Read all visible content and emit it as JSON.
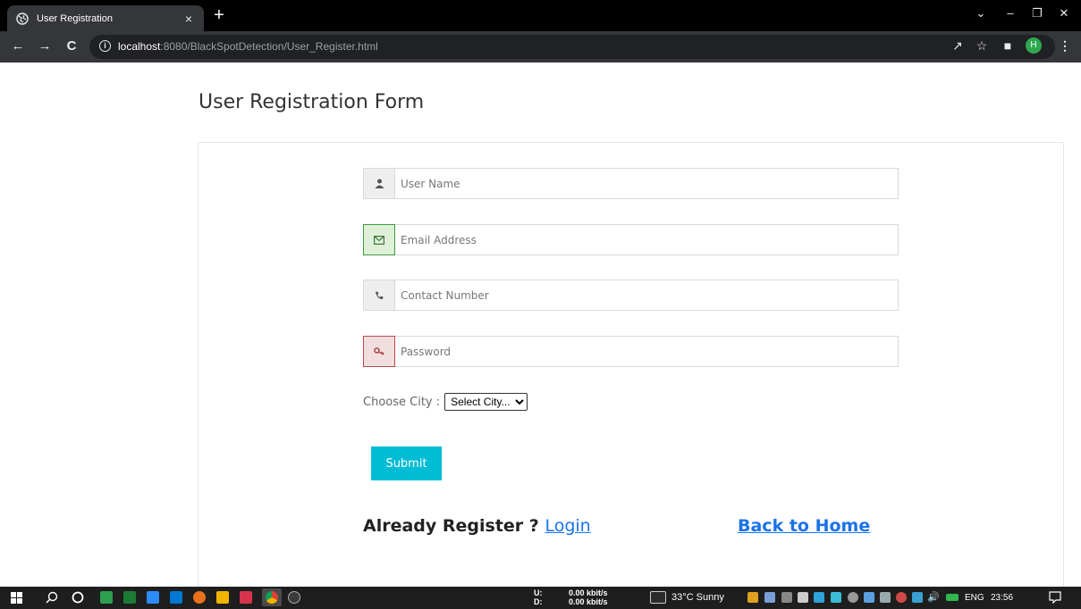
{
  "browser": {
    "tab_title": "User Registration",
    "tab_close": "×",
    "new_tab": "+",
    "url_host": "localhost",
    "url_rest": ":8080/BlackSpotDetection/User_Register.html",
    "avatar_letter": "H",
    "colors": {
      "tabstrip": "#000000",
      "toolbar": "#35363a",
      "avatar": "#2fa84f"
    }
  },
  "page": {
    "title": "User Registration Form",
    "fields": {
      "username_placeholder": "User Name",
      "email_placeholder": "Email Address",
      "contact_placeholder": "Contact Number",
      "password_placeholder": "Password"
    },
    "city_label": "Choose City :",
    "city_selected": "Select City...",
    "submit_label": "Submit",
    "already_text": "Already Register ?",
    "login_link": "Login",
    "home_link": "Back to Home",
    "colors": {
      "submit": "#00bcd4",
      "link": "#1a73e8"
    }
  },
  "taskbar": {
    "net_up_label": "U:",
    "net_down_label": "D:",
    "net_up": "0.00 kbit/s",
    "net_down": "0.00 kbit/s",
    "weather": "33°C  Sunny",
    "lang": "ENG",
    "time": "23:56"
  }
}
